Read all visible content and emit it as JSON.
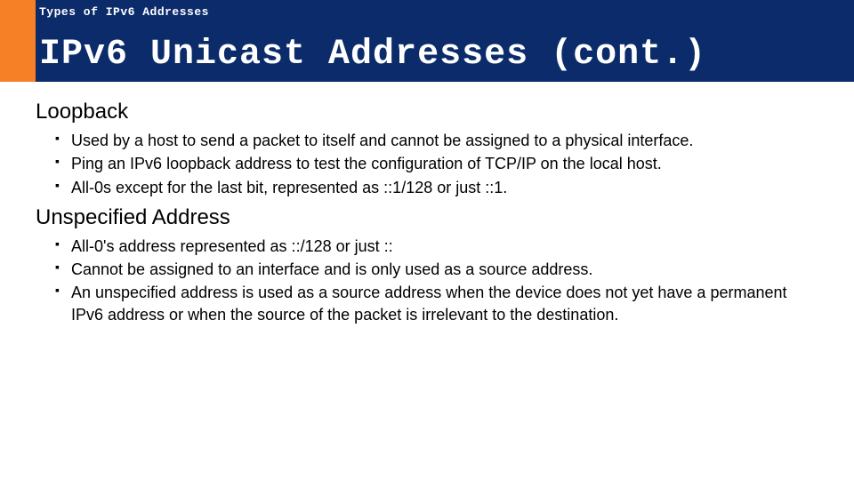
{
  "header": {
    "kicker": "Types of IPv6 Addresses",
    "title": "IPv6 Unicast Addresses (cont.)"
  },
  "sections": [
    {
      "heading": "Loopback",
      "bullets": [
        "Used by a host to send a packet to itself and cannot be assigned to a physical interface.",
        "Ping an IPv6 loopback address to test the configuration of TCP/IP on the local host.",
        "All-0s except for the last bit, represented as ::1/128 or just ::1."
      ]
    },
    {
      "heading": "Unspecified Address",
      "bullets": [
        "All-0's address represented as ::/128 or just ::",
        "Cannot be assigned to an interface and is only used as a source address.",
        "An unspecified address is used as a source address when the device does not yet have a permanent IPv6 address or when the source of the packet is irrelevant to the destination."
      ]
    }
  ]
}
